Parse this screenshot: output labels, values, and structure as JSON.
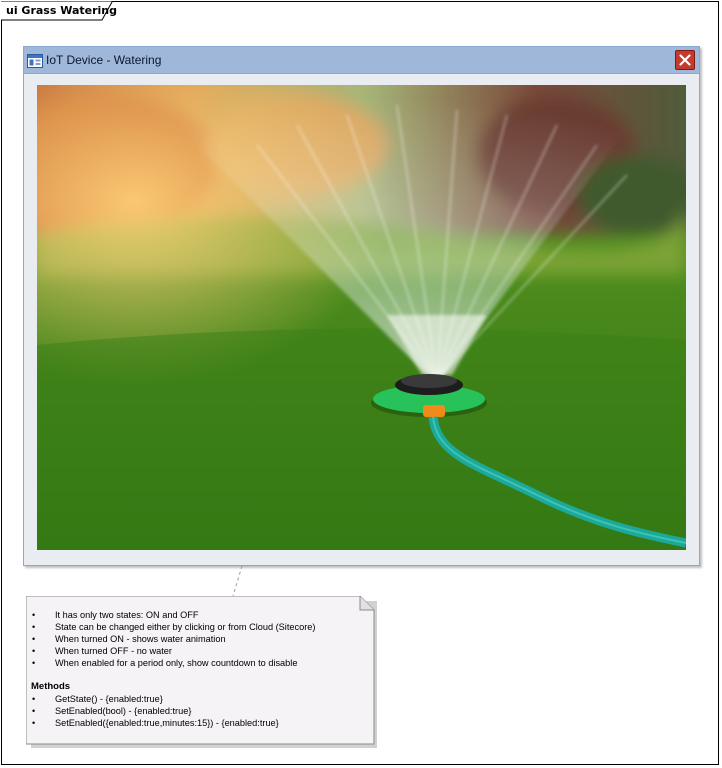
{
  "frame": {
    "title": "ui Grass Watering"
  },
  "window": {
    "title": "IoT Device - Watering",
    "icon": "window-icon",
    "close_icon": "close-icon"
  },
  "photo": {
    "subject": "lawn sprinkler spraying water on grass"
  },
  "note": {
    "bullets": [
      "It has only two states: ON and OFF",
      "State can be changed either by clicking or from Cloud (Sitecore)",
      "When turned ON - shows water animation",
      "When turned OFF - no water",
      "When enabled for a period only, show countdown to disable"
    ],
    "methods_heading": "Methods",
    "methods": [
      "GetState() - {enabled:true}",
      "SetEnabled(bool)  - {enabled:true}",
      "SetEnabled({enabled:true,minutes:15})  - {enabled:true}"
    ],
    "bullet_char": "•"
  },
  "colors": {
    "window_border": "#8aa9d2",
    "titlebar": "#9fb7d8",
    "close_button": "#c43a2e",
    "note_fill": "#f5f3f5"
  }
}
